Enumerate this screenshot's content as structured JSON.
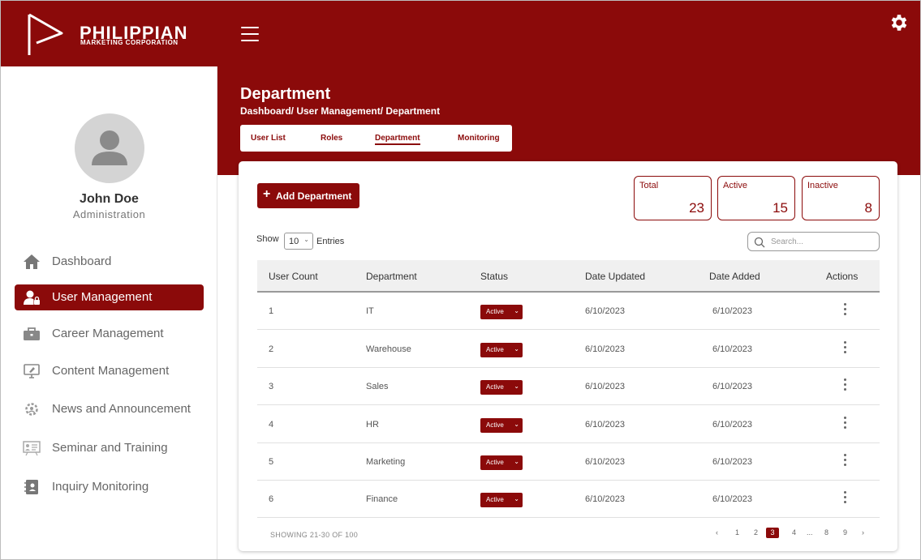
{
  "brand": {
    "title": "PHILIPPIAN",
    "subtitle": "MARKETING CORPORATION",
    "color": "#8b0a0a"
  },
  "user": {
    "name": "John Doe",
    "role": "Administration"
  },
  "sidebar": {
    "items": [
      {
        "label": "Dashboard",
        "icon": "home-icon"
      },
      {
        "label": "User Management",
        "icon": "user-lock-icon",
        "active": true
      },
      {
        "label": "Career Management",
        "icon": "briefcase-icon"
      },
      {
        "label": "Content Management",
        "icon": "monitor-edit-icon"
      },
      {
        "label": "News and Announcement",
        "icon": "gear-people-icon"
      },
      {
        "label": "Seminar and Training",
        "icon": "presentation-icon"
      },
      {
        "label": "Inquiry Monitoring",
        "icon": "contact-book-icon"
      }
    ]
  },
  "page": {
    "title": "Department",
    "breadcrumb": "Dashboard/ User Management/ Department"
  },
  "tabs": [
    {
      "label": "User List"
    },
    {
      "label": "Roles"
    },
    {
      "label": "Department",
      "active": true
    },
    {
      "label": "Monitoring"
    }
  ],
  "toolbar": {
    "add_label": "Add Department",
    "plus": "+"
  },
  "stats": [
    {
      "label": "Total",
      "value": "23"
    },
    {
      "label": "Active",
      "value": "15"
    },
    {
      "label": "Inactive",
      "value": "8"
    }
  ],
  "table_controls": {
    "show_label": "Show",
    "page_size": "10",
    "entries_label": "Entries",
    "search_placeholder": "Search..."
  },
  "table": {
    "columns": [
      "User Count",
      "Department",
      "Status",
      "Date Updated",
      "Date Added",
      "Actions"
    ],
    "rows": [
      {
        "count": "1",
        "department": "IT",
        "status": "Active",
        "updated": "6/10/2023",
        "added": "6/10/2023"
      },
      {
        "count": "2",
        "department": "Warehouse",
        "status": "Active",
        "updated": "6/10/2023",
        "added": "6/10/2023"
      },
      {
        "count": "3",
        "department": "Sales",
        "status": "Active",
        "updated": "6/10/2023",
        "added": "6/10/2023"
      },
      {
        "count": "4",
        "department": "HR",
        "status": "Active",
        "updated": "6/10/2023",
        "added": "6/10/2023"
      },
      {
        "count": "5",
        "department": "Marketing",
        "status": "Active",
        "updated": "6/10/2023",
        "added": "6/10/2023"
      },
      {
        "count": "6",
        "department": "Finance",
        "status": "Active",
        "updated": "6/10/2023",
        "added": "6/10/2023"
      }
    ]
  },
  "footer": {
    "showing": "SHOWING 21-30 OF 100",
    "pages": [
      "‹",
      "1",
      "2",
      "3",
      "4",
      "...",
      "8",
      "9",
      "›"
    ],
    "current_page": "3"
  }
}
